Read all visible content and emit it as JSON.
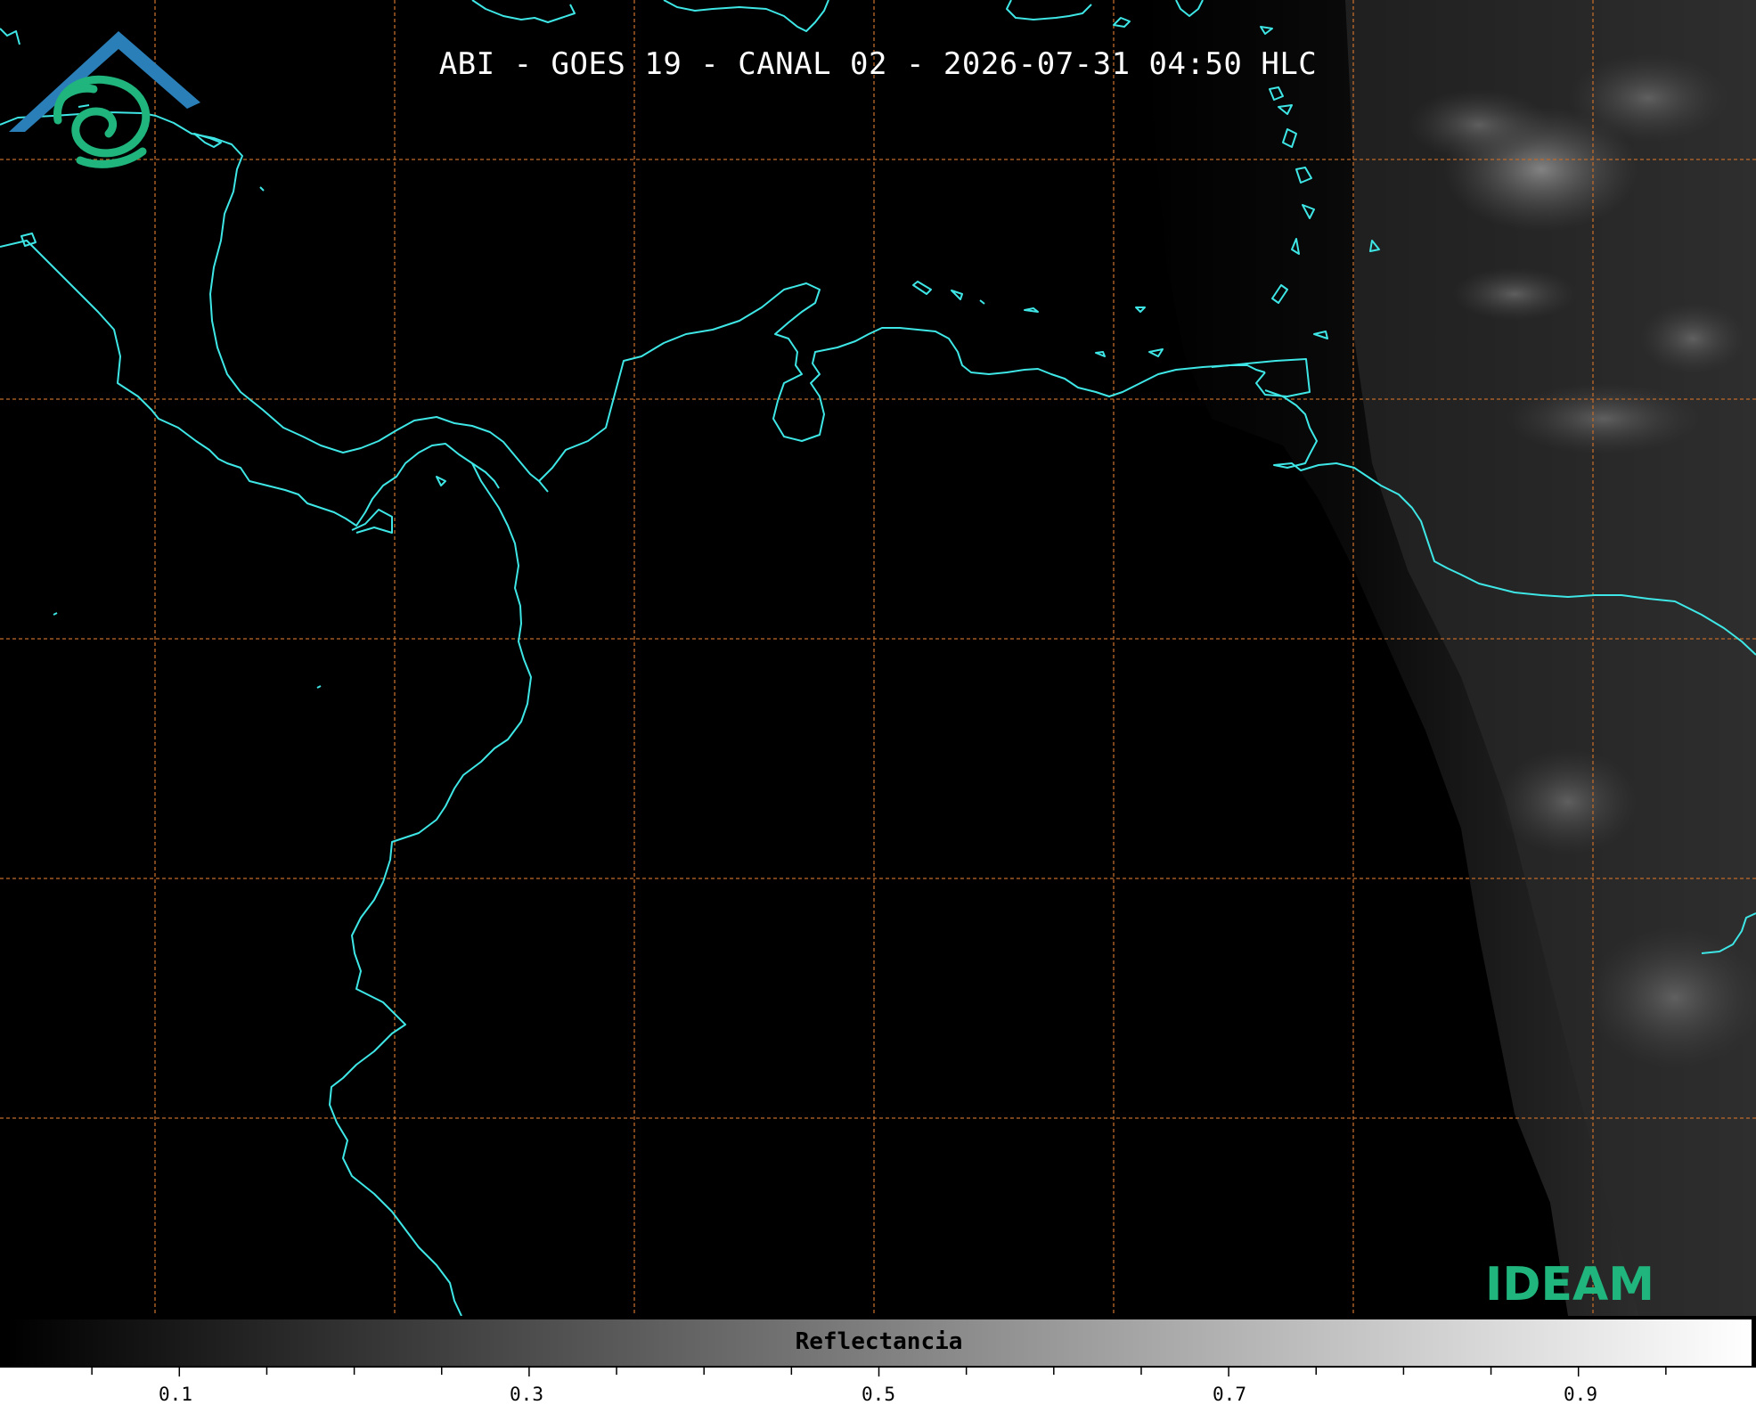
{
  "title": "ABI - GOES 19 - CANAL 02 - 2026-07-31 04:50 HLC",
  "logo": {
    "text": "IDEAM",
    "colors": {
      "roof": "#2b7fb8",
      "swirl": "#1fb57d",
      "text": "#1fb57d"
    }
  },
  "colorbar": {
    "label": "Reflectancia",
    "range": [
      0.0,
      1.0
    ],
    "major_ticks": [
      "0.1",
      "0.3",
      "0.5",
      "0.7",
      "0.9"
    ],
    "colormap": "grayscale black-to-white"
  },
  "map": {
    "coastline_color": "#3fe6e6",
    "grid_color": "#c06a2a",
    "grid_style": "dashed"
  }
}
